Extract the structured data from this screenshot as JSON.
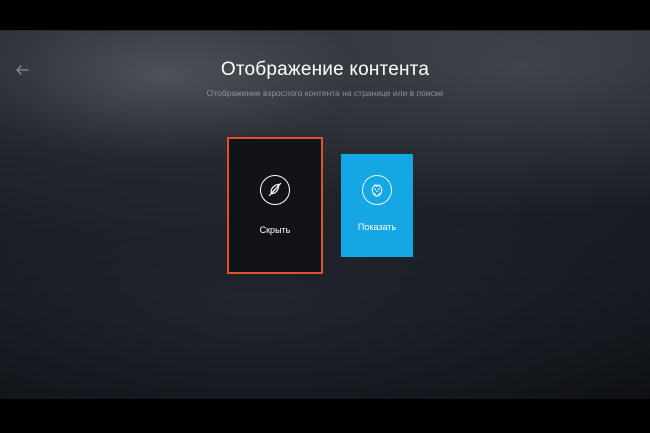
{
  "page": {
    "title": "Отображение контента",
    "subtitle": "Отображение взрослого контента на странице или в поиске"
  },
  "options": {
    "hide": {
      "label": "Скрыть",
      "icon": "content-hidden-icon",
      "selected": true,
      "border_color": "#e0502a"
    },
    "show": {
      "label": "Показать",
      "icon": "content-shown-icon",
      "selected": false,
      "background_color": "#15a7e4"
    }
  },
  "navigation": {
    "back_icon": "arrow-left-icon"
  }
}
